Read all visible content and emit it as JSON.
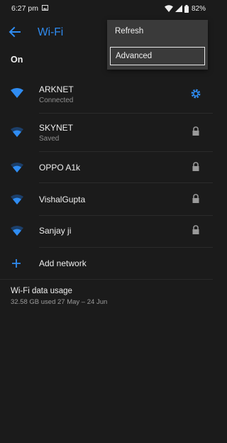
{
  "status": {
    "time": "6:27 pm",
    "battery": "82%",
    "icons": [
      "gallery-icon",
      "wifi-icon",
      "cell-signal-icon",
      "battery-icon"
    ]
  },
  "header": {
    "title": "Wi-Fi",
    "back_icon": "back-arrow-icon"
  },
  "toggle_label": "On",
  "networks": [
    {
      "name": "ARKNET",
      "status": "Connected",
      "trailing_icon": "gear-icon",
      "signal": 4
    },
    {
      "name": "SKYNET",
      "status": "Saved",
      "trailing_icon": "lock-icon",
      "signal": 3
    },
    {
      "name": "OPPO A1k",
      "status": "",
      "trailing_icon": "lock-icon",
      "signal": 3
    },
    {
      "name": "VishalGupta",
      "status": "",
      "trailing_icon": "lock-icon",
      "signal": 3
    },
    {
      "name": "Sanjay ji",
      "status": "",
      "trailing_icon": "lock-icon",
      "signal": 3
    }
  ],
  "add_network": {
    "label": "Add network",
    "icon": "plus-icon"
  },
  "usage": {
    "title": "Wi-Fi data usage",
    "detail": "32.58 GB used 27 May – 24 Jun"
  },
  "overflow_menu": {
    "items": [
      "Refresh",
      "Advanced"
    ]
  },
  "colors": {
    "background": "#1b1b1b",
    "accent": "#2f8cf2",
    "menu_background": "#3a3a3a"
  }
}
